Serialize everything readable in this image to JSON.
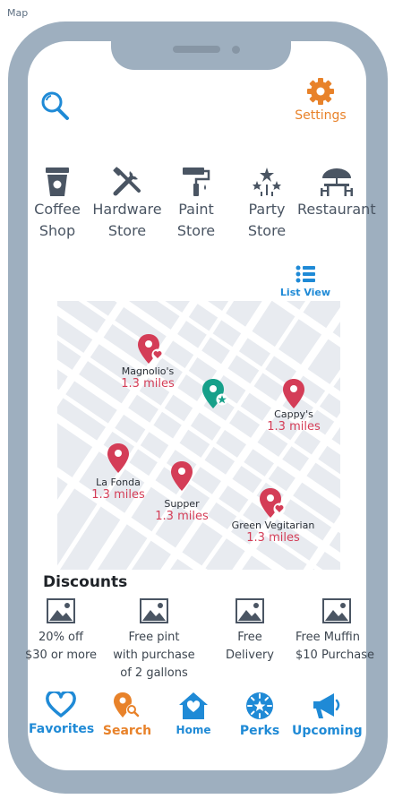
{
  "frame": {
    "label": "Map"
  },
  "header": {
    "search_icon": "search-icon",
    "settings_label": "Settings",
    "settings_icon": "gear-icon"
  },
  "categories": [
    {
      "label": "Coffee\nShop",
      "icon": "coffee-cup-icon"
    },
    {
      "label": "Hardware\nStore",
      "icon": "tools-icon"
    },
    {
      "label": "Paint\nStore",
      "icon": "paint-roller-icon"
    },
    {
      "label": "Party\nStore",
      "icon": "fireworks-icon"
    },
    {
      "label": "Restaurant",
      "icon": "restaurant-table-icon"
    }
  ],
  "view_toggle": {
    "label": "List View",
    "icon": "list-icon"
  },
  "map": {
    "pins": [
      {
        "name": "Magnolio's",
        "distance": "1.3 miles",
        "icon": "pin-heart-icon"
      },
      {
        "name": "Cappy's",
        "distance": "1.3 miles",
        "icon": "pin-icon"
      },
      {
        "name": "La Fonda",
        "distance": "1.3 miles",
        "icon": "pin-icon"
      },
      {
        "name": "Supper",
        "distance": "1.3 miles",
        "icon": "pin-icon"
      },
      {
        "name": "Green Vegitarian",
        "distance": "1.3 miles",
        "icon": "pin-heart-icon"
      }
    ],
    "current_location_icon": "pin-star-icon"
  },
  "discounts": {
    "title": "Discounts",
    "items": [
      {
        "text": "20% off\n$30 or more",
        "icon": "image-icon"
      },
      {
        "text": "Free pint\nwith purchase\nof 2 gallons",
        "icon": "image-icon"
      },
      {
        "text": "Free\nDelivery",
        "icon": "image-icon"
      },
      {
        "text": "Free Muffin\n$10 Purchase",
        "icon": "image-icon"
      }
    ]
  },
  "tabs": [
    {
      "label": "Favorites",
      "icon": "heart-icon",
      "color": "#1f8ad6"
    },
    {
      "label": "Search",
      "icon": "location-search-icon",
      "color": "#e8822a"
    },
    {
      "label": "Home",
      "icon": "home-icon",
      "color": "#1f8ad6"
    },
    {
      "label": "Perks",
      "icon": "star-badge-icon",
      "color": "#1f8ad6"
    },
    {
      "label": "Upcoming",
      "icon": "megaphone-icon",
      "color": "#1f8ad6"
    }
  ],
  "colors": {
    "accent_blue": "#1f8ad6",
    "accent_orange": "#e8822a",
    "pin_red": "#d43d57",
    "pin_teal": "#17a08a",
    "frame": "#9eafbf"
  }
}
